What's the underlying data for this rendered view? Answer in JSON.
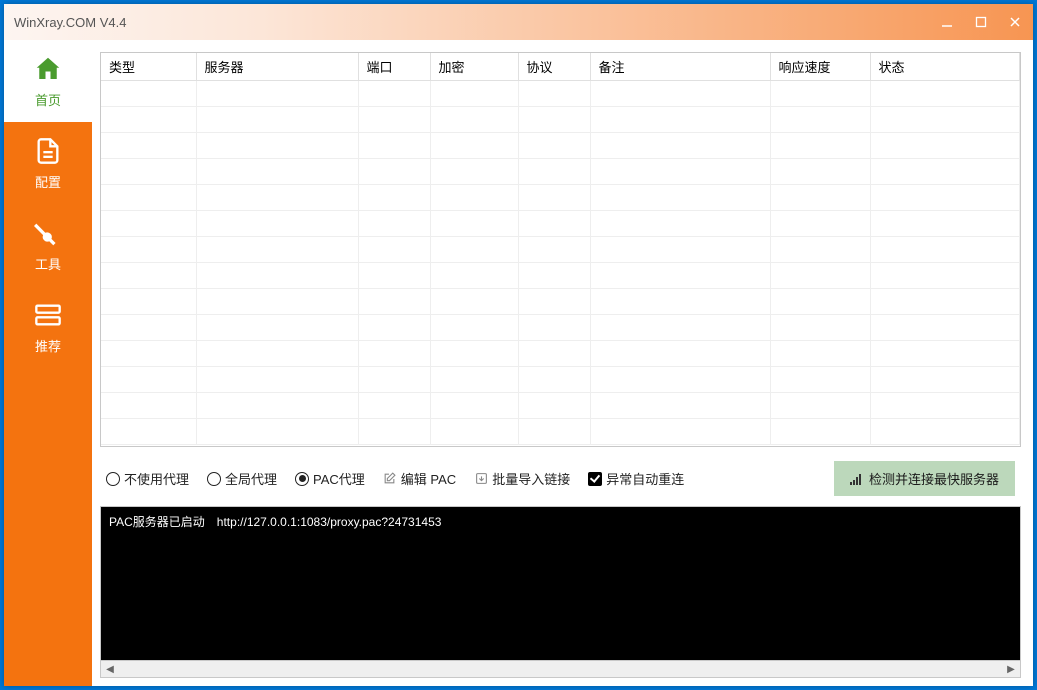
{
  "titlebar": {
    "title": "WinXray.COM   V4.4"
  },
  "sidebar": {
    "items": [
      {
        "label": "首页"
      },
      {
        "label": "配置"
      },
      {
        "label": "工具"
      },
      {
        "label": "推荐"
      }
    ]
  },
  "table": {
    "headers": [
      "类型",
      "服务器",
      "端口",
      "加密",
      "协议",
      "备注",
      "响应速度",
      "状态"
    ]
  },
  "controls": {
    "radio_none": "不使用代理",
    "radio_global": "全局代理",
    "radio_pac": "PAC代理",
    "edit_pac": "编辑 PAC",
    "bulk_import": "批量导入链接",
    "auto_reconnect": "异常自动重连",
    "detect_btn": "检测并连接最快服务器"
  },
  "console": {
    "log_prefix": "PAC服务器已启动",
    "log_url": "http://127.0.0.1:1083/proxy.pac?24731453"
  }
}
